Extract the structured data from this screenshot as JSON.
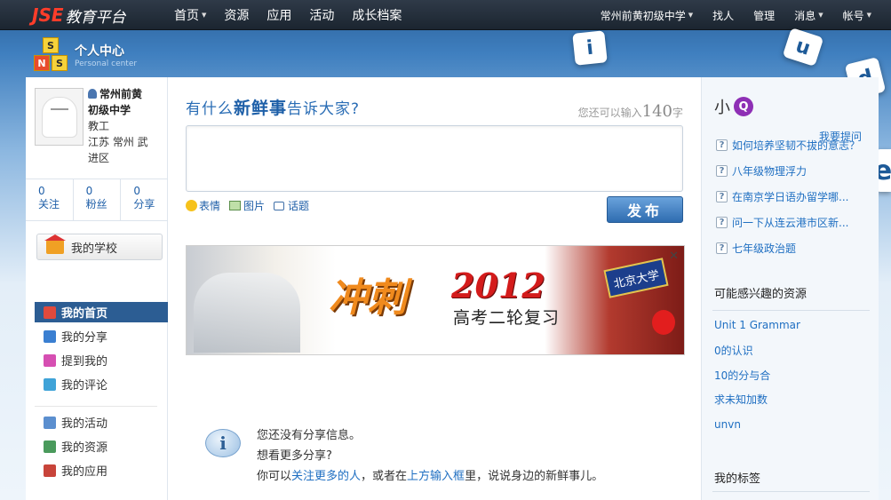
{
  "topnav": {
    "logo_brand": "JSE",
    "logo_text": "教育平台",
    "left_items": [
      "首页",
      "资源",
      "应用",
      "活动",
      "成长档案"
    ],
    "school": "常州前黄初级中学",
    "find": "找人",
    "manage": "管理",
    "messages": "消息",
    "account": "帐号"
  },
  "header": {
    "sns_letters": [
      "S",
      "N",
      "S"
    ],
    "title": "个人中心",
    "subtitle": "Personal center"
  },
  "deco_letters": [
    "i",
    "u",
    "d",
    "e"
  ],
  "profile": {
    "name_line1": "常州前黄",
    "name_line2": "初级中学",
    "role": "教工",
    "location_line1": "江苏  常州  武",
    "location_line2": "进区",
    "stats": [
      {
        "num": "0",
        "label": "关注"
      },
      {
        "num": "0",
        "label": "粉丝"
      },
      {
        "num": "0",
        "label": "分享"
      }
    ],
    "my_school": "我的学校"
  },
  "menu_group1": [
    {
      "label": "我的首页",
      "icon": "home-icon",
      "color": "#e04a3c",
      "active": true
    },
    {
      "label": "我的分享",
      "icon": "share-icon",
      "color": "#3a7fd1"
    },
    {
      "label": "提到我的",
      "icon": "mention-icon",
      "color": "#d64fb2"
    },
    {
      "label": "我的评论",
      "icon": "comment-icon",
      "color": "#3fa3d8"
    }
  ],
  "menu_group2": [
    {
      "label": "我的活动",
      "icon": "activity-icon",
      "color": "#5b8fcf"
    },
    {
      "label": "我的资源",
      "icon": "resource-icon",
      "color": "#4a9a5c"
    },
    {
      "label": "我的应用",
      "icon": "app-icon",
      "color": "#c8443a"
    }
  ],
  "composer": {
    "prompt_a": "有什么",
    "prompt_b": "新鲜事",
    "prompt_c": "告诉大家?",
    "counter_prefix": "您还可以输入",
    "counter_num": "140",
    "counter_suffix": "字",
    "tool_emotion": "表情",
    "tool_image": "图片",
    "tool_topic": "话题",
    "publish": "发布"
  },
  "ad": {
    "title": "冲刺",
    "year": "2012",
    "subtitle": "高考二轮复习",
    "sign": "北京大学"
  },
  "empty_state": {
    "line1": "您还没有分享信息。",
    "line2": "想看更多分享?",
    "line3_a": "你可以",
    "line3_link1": "关注更多的人",
    "line3_b": "，或者在",
    "line3_link2": "上方输入框",
    "line3_c": "里，说说身边的新鲜事儿。"
  },
  "sidebar_right": {
    "xq_label": "小",
    "xq_badge": "Q",
    "ask_link": "我要提问",
    "questions": [
      "如何培养坚韧不拔的意志？",
      "八年级物理浮力",
      "在南京学日语办留学哪...",
      "问一下从连云港市区新...",
      "七年级政治题"
    ],
    "resources_title": "可能感兴趣的资源",
    "resources": [
      "Unit 1 Grammar",
      "0的认识",
      "10的分与合",
      "求未知加数",
      "unvn"
    ],
    "tags_title": "我的标签"
  }
}
